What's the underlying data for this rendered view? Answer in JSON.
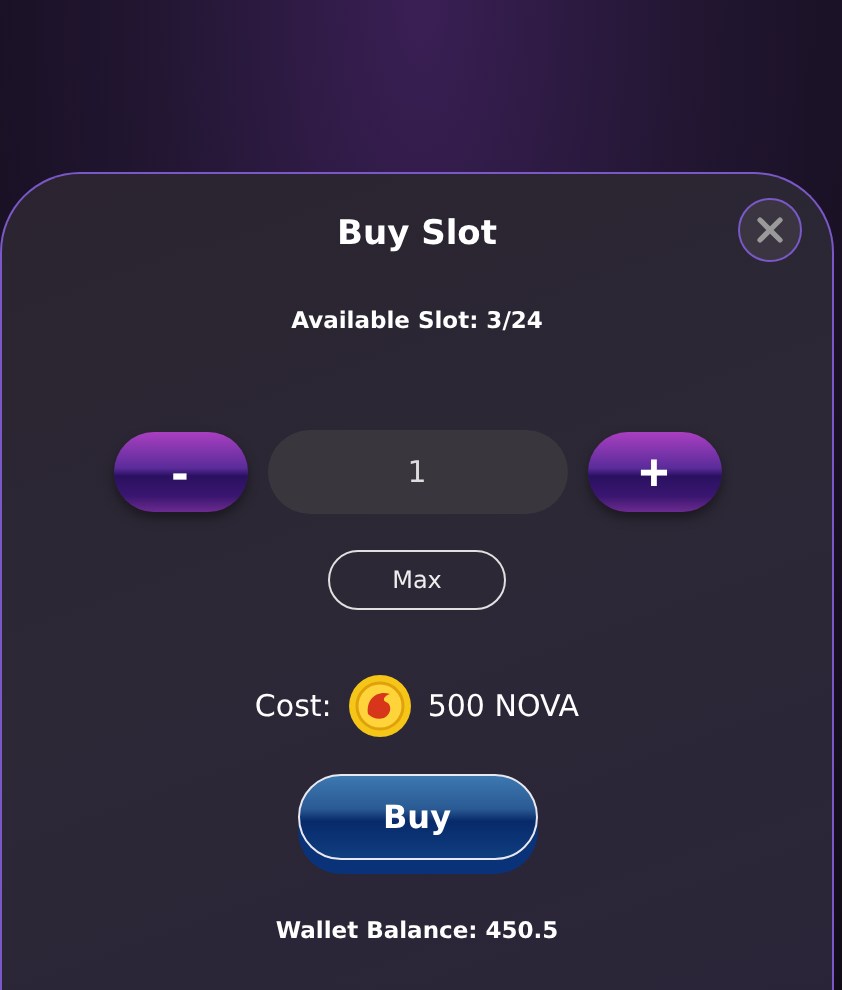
{
  "dialog": {
    "title": "Buy Slot",
    "available": "Available Slot: 3/24"
  },
  "quantity": {
    "value": "1",
    "decrement": "-",
    "increment": "+"
  },
  "max_button": "Max",
  "cost": {
    "label": "Cost:",
    "amount": "500 NOVA"
  },
  "buy_button": "Buy",
  "wallet_balance": "Wallet Balance: 450.5"
}
